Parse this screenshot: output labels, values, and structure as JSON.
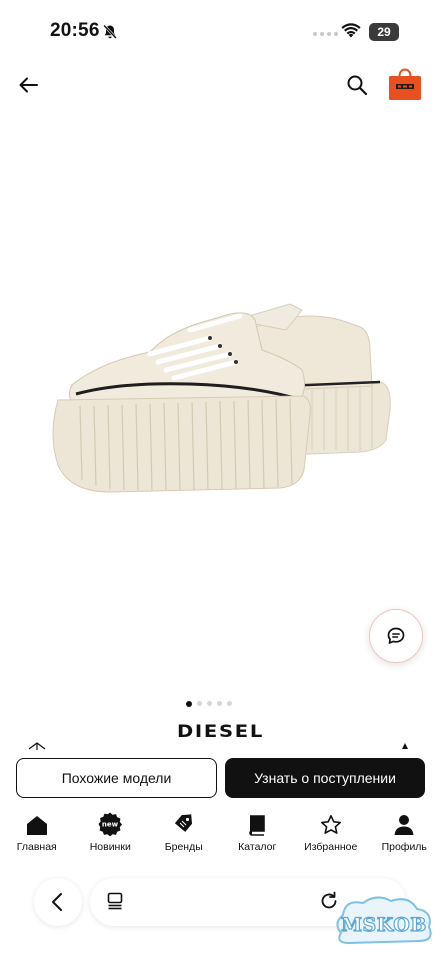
{
  "status_bar": {
    "time": "20:56",
    "battery": "29"
  },
  "header": {
    "back_icon": "arrow-left-icon",
    "search_icon": "search-icon",
    "bag_icon": "shopping-bag-icon",
    "bag_color": "#e8501f"
  },
  "product": {
    "brand": "DIESEL",
    "image_description": "cream-platform-sneakers",
    "gallery": {
      "total_pages": 5,
      "current_page": 1
    }
  },
  "actions": {
    "similar_label": "Похожие модели",
    "notify_label": "Узнать о поступлении"
  },
  "tab_bar": {
    "items": [
      {
        "label": "Главная",
        "icon": "home-icon"
      },
      {
        "label": "Новинки",
        "icon": "new-badge-icon",
        "badge": "new"
      },
      {
        "label": "Бренды",
        "icon": "tag-icon"
      },
      {
        "label": "Каталог",
        "icon": "book-icon"
      },
      {
        "label": "Избранное",
        "icon": "star-icon"
      },
      {
        "label": "Профиль",
        "icon": "person-icon"
      }
    ]
  },
  "browser": {
    "back_icon": "chevron-left-icon",
    "tabs_icon": "tabs-icon",
    "reload_icon": "reload-icon"
  },
  "watermark": {
    "text": "MSKOB"
  },
  "colors": {
    "accent": "#e8501f",
    "primary_button": "#111111",
    "background": "#ffffff"
  }
}
